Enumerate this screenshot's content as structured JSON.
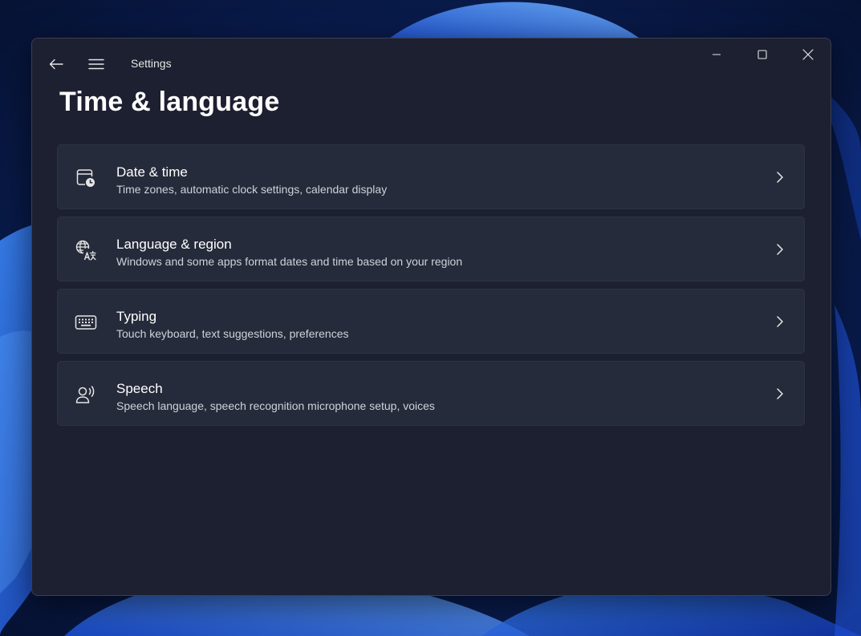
{
  "window": {
    "title": "Settings"
  },
  "page": {
    "title": "Time & language"
  },
  "items": [
    {
      "id": "date-time",
      "icon": "calendar-clock-icon",
      "title": "Date & time",
      "subtitle": "Time zones, automatic clock settings, calendar display"
    },
    {
      "id": "language-region",
      "icon": "globe-language-icon",
      "title": "Language & region",
      "subtitle": "Windows and some apps format dates and time based on your region"
    },
    {
      "id": "typing",
      "icon": "keyboard-icon",
      "title": "Typing",
      "subtitle": "Touch keyboard, text suggestions, preferences"
    },
    {
      "id": "speech",
      "icon": "speech-icon",
      "title": "Speech",
      "subtitle": "Speech language, speech recognition microphone setup, voices"
    }
  ],
  "colors": {
    "window_bg": "#1c2030",
    "card_bg": "#262b3b",
    "text_primary": "#ffffff",
    "text_secondary": "#cfd2da",
    "wallpaper_dark": "#0a1a4e",
    "wallpaper_accent": "#1f5ce8"
  }
}
